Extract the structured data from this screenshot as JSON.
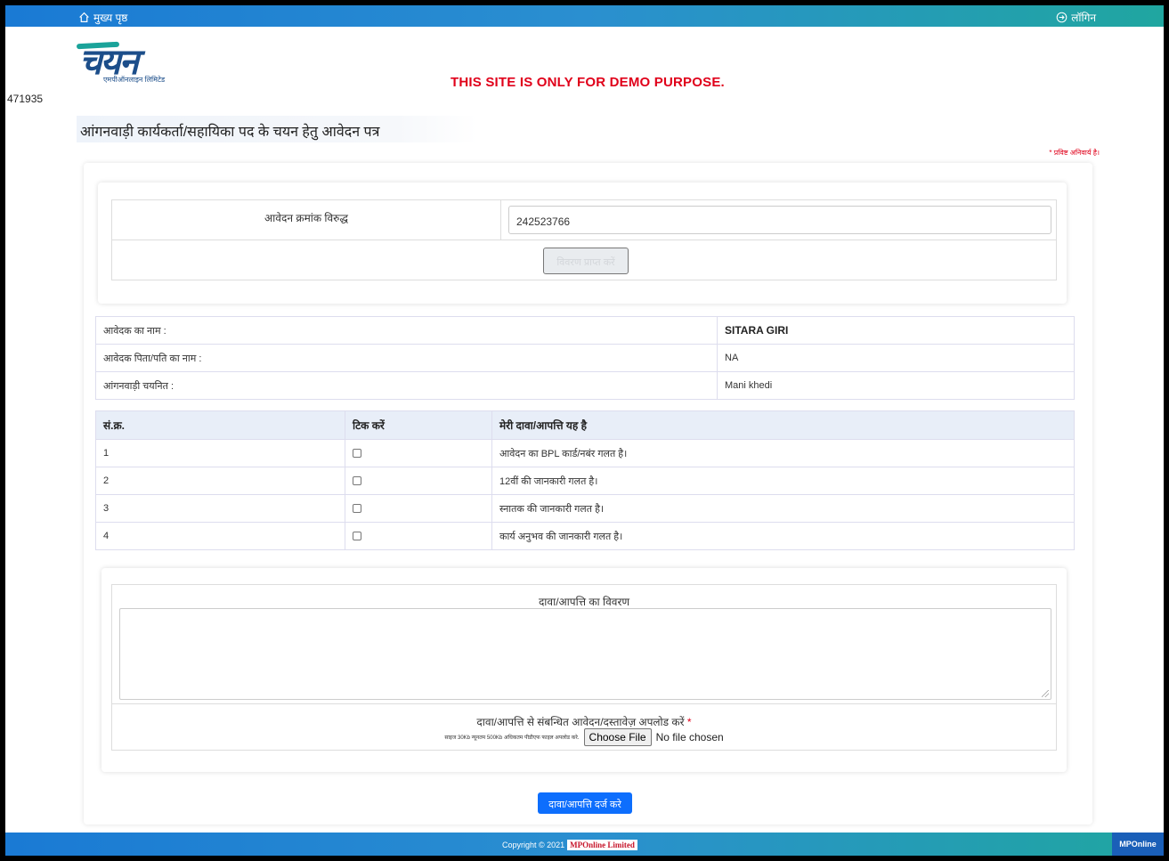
{
  "topbar": {
    "home_label": "मुख्य पृष्ठ",
    "login_label": "लॉगिन"
  },
  "header": {
    "logo_text": "चयन",
    "logo_subtitle": "एमपीऑनलाइन लिमिटेड",
    "demo_notice": "THIS SITE IS ONLY FOR DEMO PURPOSE.",
    "visitor_counter": "471935"
  },
  "page": {
    "title": "आंगनवाड़ी कार्यकर्ता/सहायिका पद के चयन हेतु आवेदन पत्र",
    "required_note": "* प्रविष्ट अनिवार्य है।"
  },
  "application_lookup": {
    "label": "आवेदन क्रमांक विरुद्ध",
    "value": "242523766",
    "button_label": "विवरण प्राप्त करें"
  },
  "applicant": [
    {
      "label": "आवेदक का नाम :",
      "value": "SITARA GIRI",
      "bold": true
    },
    {
      "label": "आवेदक पिता/पति का नाम :",
      "value": "NA",
      "bold": false
    },
    {
      "label": "आंगनवाड़ी चयनित :",
      "value": "Mani khedi",
      "bold": false
    }
  ],
  "claims": {
    "headers": [
      "सं.क्र.",
      "टिक करें",
      "मेरी दावा/आपत्ति यह है"
    ],
    "rows": [
      {
        "no": "1",
        "checked": false,
        "text": "आवेदन का BPL कार्ड/नबंर गलत है।"
      },
      {
        "no": "2",
        "checked": false,
        "text": "12वीं की जानकारी गलत है।"
      },
      {
        "no": "3",
        "checked": false,
        "text": "स्नातक की जानकारी गलत है।"
      },
      {
        "no": "4",
        "checked": false,
        "text": "कार्य अनुभव की जानकारी गलत है।"
      }
    ]
  },
  "description": {
    "label": "दावा/आपत्ति का विवरण",
    "value": ""
  },
  "upload": {
    "label": "दावा/आपत्ति से संबन्धित आवेदन/दस्तावेज़ अपलोड करें",
    "required_mark": "*",
    "hint": "साइज 30Kb न्यूनतम 500Kb अधिकतम पीडीएफ फाइल अपलोड करे.",
    "button_label": "Choose File",
    "status": "No file chosen"
  },
  "submit_label": "दावा/आपत्ति दर्ज करे",
  "footer": {
    "copyright": "Copyright © 2021",
    "brand": "MPOnline Limited",
    "corner_label": "MPOnline"
  },
  "colors": {
    "accent": "#0d6efd",
    "demo_red": "#e0001a",
    "bar_blue": "#1a7ad4",
    "bar_teal": "#20a6a0"
  },
  "icons": {
    "home": "home-icon",
    "login": "login-arrow-icon"
  }
}
